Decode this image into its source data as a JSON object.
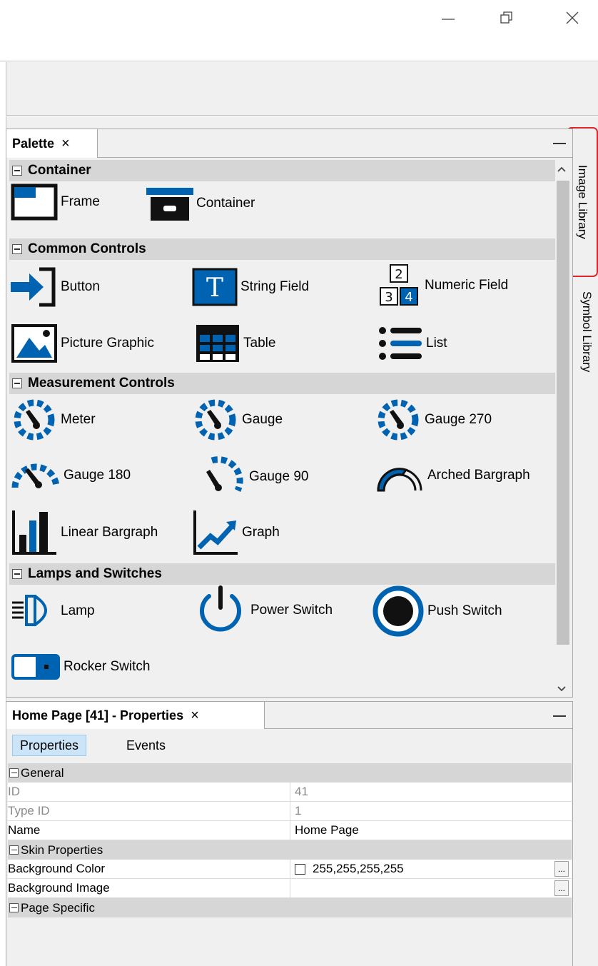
{
  "window": {
    "controls": {
      "minimize_icon": "minimize-icon",
      "restore_icon": "restore-icon",
      "close_icon": "close-icon"
    }
  },
  "side_tabs": [
    {
      "label": "Image Library",
      "highlighted": true,
      "highlight_color": "#e0242c"
    },
    {
      "label": "Symbol Library",
      "highlighted": false
    }
  ],
  "palette": {
    "tab_title": "Palette",
    "tab_close": "×",
    "categories": [
      {
        "label": "Container",
        "items": [
          "Frame",
          "Container"
        ]
      },
      {
        "label": "Common Controls",
        "items": [
          "Button",
          "String Field",
          "Numeric Field",
          "Picture Graphic",
          "Table",
          "List"
        ]
      },
      {
        "label": "Measurement Controls",
        "items": [
          "Meter",
          "Gauge",
          "Gauge 270",
          "Gauge 180",
          "Gauge 90",
          "Arched Bargraph",
          "Linear Bargraph",
          "Graph"
        ]
      },
      {
        "label": "Lamps and Switches",
        "items": [
          "Lamp",
          "Power Switch",
          "Push Switch",
          "Rocker Switch"
        ]
      }
    ],
    "numeric_icon_digits": [
      "2",
      "3",
      "4"
    ],
    "string_icon_letter": "T"
  },
  "properties": {
    "tab_title": "Home Page [41] - Properties",
    "tab_close": "×",
    "subtabs": [
      "Properties",
      "Events"
    ],
    "sections": [
      {
        "label": "General",
        "rows": [
          {
            "key": "ID",
            "value": "41",
            "readonly": true
          },
          {
            "key": "Type ID",
            "value": "1",
            "readonly": true
          },
          {
            "key": "Name",
            "value": "Home Page",
            "readonly": false
          }
        ]
      },
      {
        "label": "Skin Properties",
        "rows": [
          {
            "key": "Background Color",
            "value": "255,255,255,255",
            "readonly": false,
            "ellipsis": "..."
          },
          {
            "key": "Background Image",
            "value": "",
            "readonly": false,
            "ellipsis": "..."
          }
        ]
      },
      {
        "label": "Page Specific",
        "rows": []
      }
    ]
  },
  "colors": {
    "accent_blue": "#0063b1",
    "dark": "#111111",
    "highlight_red": "#e0242c"
  }
}
